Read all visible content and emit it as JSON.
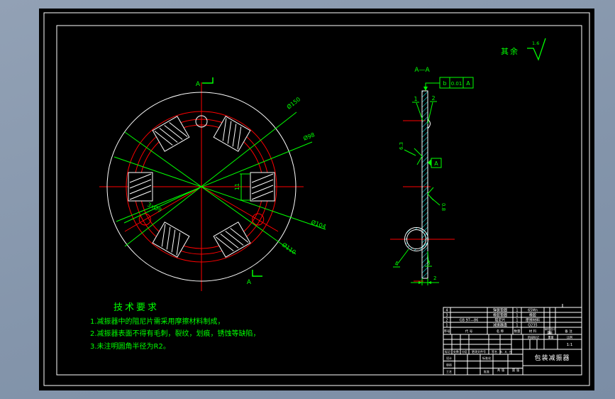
{
  "colors": {
    "background": "#8495ab",
    "canvas": "#000000",
    "geometry_white": "#ffffff",
    "dimension_green": "#00ff00",
    "centerline_red": "#ff0000",
    "hatch_cyan": "#00ffff"
  },
  "surface_note": {
    "prefix": "其余",
    "value": "1.6"
  },
  "plan_view": {
    "cut_mark": "A",
    "dims": {
      "d1": "Ø150",
      "d2": "Ø98",
      "d3": "Ø104",
      "d4": "Ø110",
      "holes": "3xØ9",
      "pad_height": "11"
    }
  },
  "section_view": {
    "label": "A—A",
    "balloons": [
      "1",
      "2",
      "3",
      "4"
    ],
    "fcf": {
      "symbol": "b",
      "tolerance": "0.01",
      "datum": "A"
    },
    "datum_label": "A",
    "roughness": {
      "left": "6.3",
      "right": "0.8"
    },
    "thickness": "2"
  },
  "tech_requirements": {
    "title": "技术要求",
    "items": [
      "1.减振器中的阻尼片需采用摩擦材料制成，",
      "2.减振器表面不得有毛刺，裂纹，划痕，锈蚀等缺陷，",
      "3.未注明圆角半径为R2。"
    ]
  },
  "bom": {
    "headers": {
      "seq": "序号",
      "code": "代 号",
      "name": "名 称",
      "qty": "数量",
      "material": "材 料",
      "unit": "单件",
      "total": "总计",
      "weight": "重量",
      "remark": "备 注"
    },
    "rows": [
      {
        "seq": "4",
        "code": "",
        "name": "弹簧垫圈",
        "qty": "1",
        "material": "65Mn"
      },
      {
        "seq": "3",
        "code": "",
        "name": "橡胶垫圈",
        "qty": "1",
        "material": "橡胶"
      },
      {
        "seq": "2",
        "code": "GB 97—86",
        "name": "阻尼片",
        "qty": "1",
        "material": "摩擦材料"
      },
      {
        "seq": "1",
        "code": "",
        "name": "减振器盘",
        "qty": "1",
        "material": "Q235"
      }
    ]
  },
  "title_block": {
    "part_name": "包装减振器",
    "scale_value": "1:1",
    "labels": {
      "mark": "标记",
      "count": "处数",
      "zone": "分区",
      "doc_no": "更改文件号",
      "sign": "签名",
      "date": "年、月、日",
      "design": "设计",
      "check": "审核",
      "process": "工艺",
      "standard": "标准化",
      "approve": "批准",
      "stage": "阶段标记",
      "weight": "重量",
      "scale": "比例",
      "sheets": "共 张",
      "sheet_no": "第 张"
    }
  }
}
